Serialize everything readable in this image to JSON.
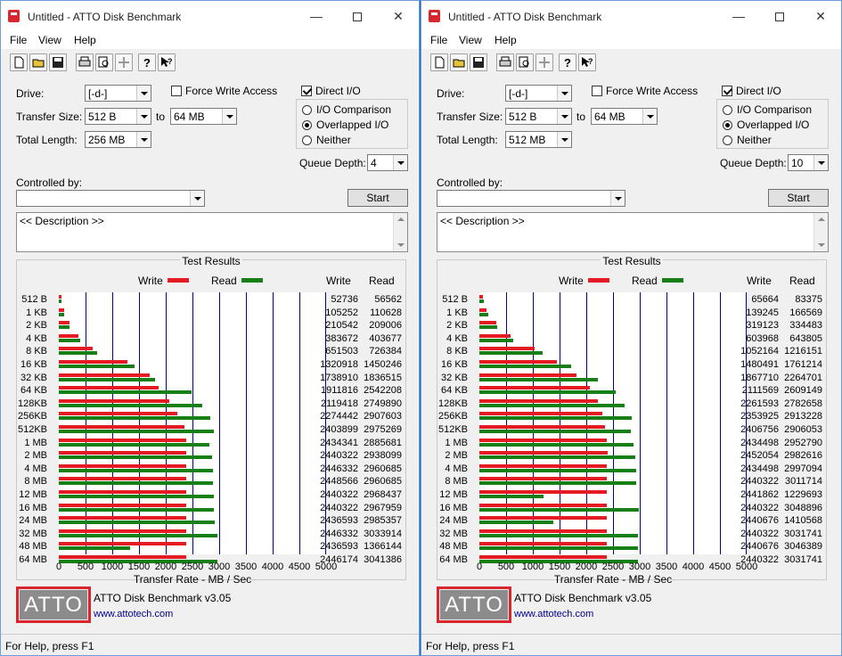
{
  "colors": {
    "write": "#e41b23",
    "read": "#168016",
    "grid": "#00008b",
    "logo": "#d9262e"
  },
  "windows": [
    {
      "title": "Untitled - ATTO Disk Benchmark",
      "menu": [
        "File",
        "View",
        "Help"
      ],
      "drive_label": "Drive:",
      "drive_value": "[-d-]",
      "force_write_label": "Force Write Access",
      "force_write_checked": false,
      "direct_io_label": "Direct I/O",
      "direct_io_checked": true,
      "transfer_size_label": "Transfer Size:",
      "transfer_from": "512 B",
      "to_label": "to",
      "transfer_to": "64 MB",
      "total_length_label": "Total Length:",
      "total_length": "256 MB",
      "io_options": [
        "I/O Comparison",
        "Overlapped I/O",
        "Neither"
      ],
      "io_selected": 1,
      "queue_depth_label": "Queue Depth:",
      "queue_depth": "4",
      "controlled_by_label": "Controlled by:",
      "controlled_by_value": "",
      "start_label": "Start",
      "description": "<< Description >>",
      "results_title": "Test Results",
      "legend_write": "Write",
      "legend_read": "Read",
      "col_write": "Write",
      "col_read": "Read",
      "xaxis_title": "Transfer Rate - MB / Sec",
      "footer_title": "ATTO Disk Benchmark v3.05",
      "footer_link": "www.attotech.com",
      "logo_text": "ATTO",
      "status": "For Help, press F1",
      "chart_data": {
        "type": "bar",
        "orientation": "horizontal",
        "xlabel": "Transfer Rate - MB / Sec",
        "xlim": [
          0,
          5000
        ],
        "xticks": [
          0,
          500,
          1000,
          1500,
          2000,
          2500,
          3000,
          3500,
          4000,
          4500,
          5000
        ],
        "categories": [
          "512 B",
          "1 KB",
          "2 KB",
          "4 KB",
          "8 KB",
          "16 KB",
          "32 KB",
          "64 KB",
          "128KB",
          "256KB",
          "512KB",
          "1 MB",
          "2 MB",
          "4 MB",
          "8 MB",
          "12 MB",
          "16 MB",
          "24 MB",
          "32 MB",
          "48 MB",
          "64 MB"
        ],
        "series": [
          {
            "name": "Write",
            "values": [
              52736,
              105252,
              210542,
              383672,
              651503,
              1320918,
              1738910,
              1911816,
              2119418,
              2274442,
              2403899,
              2434341,
              2440322,
              2446332,
              2448566,
              2440322,
              2440322,
              2436593,
              2446332,
              2436593,
              2446174
            ]
          },
          {
            "name": "Read",
            "values": [
              56562,
              110628,
              209006,
              403677,
              726384,
              1450246,
              1836515,
              2542208,
              2749890,
              2907603,
              2975269,
              2885681,
              2938099,
              2960685,
              2960685,
              2968437,
              2967959,
              2985357,
              3033914,
              1366144,
              3041386
            ]
          }
        ]
      }
    },
    {
      "title": "Untitled - ATTO Disk Benchmark",
      "menu": [
        "File",
        "View",
        "Help"
      ],
      "drive_label": "Drive:",
      "drive_value": "[-d-]",
      "force_write_label": "Force Write Access",
      "force_write_checked": false,
      "direct_io_label": "Direct I/O",
      "direct_io_checked": true,
      "transfer_size_label": "Transfer Size:",
      "transfer_from": "512 B",
      "to_label": "to",
      "transfer_to": "64 MB",
      "total_length_label": "Total Length:",
      "total_length": "512 MB",
      "io_options": [
        "I/O Comparison",
        "Overlapped I/O",
        "Neither"
      ],
      "io_selected": 1,
      "queue_depth_label": "Queue Depth:",
      "queue_depth": "10",
      "controlled_by_label": "Controlled by:",
      "controlled_by_value": "",
      "start_label": "Start",
      "description": "<< Description >>",
      "results_title": "Test Results",
      "legend_write": "Write",
      "legend_read": "Read",
      "col_write": "Write",
      "col_read": "Read",
      "xaxis_title": "Transfer Rate - MB / Sec",
      "footer_title": "ATTO Disk Benchmark v3.05",
      "footer_link": "www.attotech.com",
      "logo_text": "ATTO",
      "status": "For Help, press F1",
      "chart_data": {
        "type": "bar",
        "orientation": "horizontal",
        "xlabel": "Transfer Rate - MB / Sec",
        "xlim": [
          0,
          5000
        ],
        "xticks": [
          0,
          500,
          1000,
          1500,
          2000,
          2500,
          3000,
          3500,
          4000,
          4500,
          5000
        ],
        "categories": [
          "512 B",
          "1 KB",
          "2 KB",
          "4 KB",
          "8 KB",
          "16 KB",
          "32 KB",
          "64 KB",
          "128KB",
          "256KB",
          "512KB",
          "1 MB",
          "2 MB",
          "4 MB",
          "8 MB",
          "12 MB",
          "16 MB",
          "24 MB",
          "32 MB",
          "48 MB",
          "64 MB"
        ],
        "series": [
          {
            "name": "Write",
            "values": [
              65664,
              139245,
              319123,
              603968,
              1052164,
              1480491,
              1867710,
              2111569,
              2261593,
              2353925,
              2406756,
              2434498,
              2452054,
              2434498,
              2440322,
              2441862,
              2440322,
              2440676,
              2440322,
              2440676,
              2440322
            ]
          },
          {
            "name": "Read",
            "values": [
              83375,
              166569,
              334483,
              643805,
              1216151,
              1761214,
              2264701,
              2609149,
              2782658,
              2913228,
              2906053,
              2952790,
              2982616,
              2997094,
              3011714,
              1229693,
              3048896,
              1410568,
              3031741,
              3046389,
              3031741
            ]
          }
        ]
      }
    }
  ]
}
